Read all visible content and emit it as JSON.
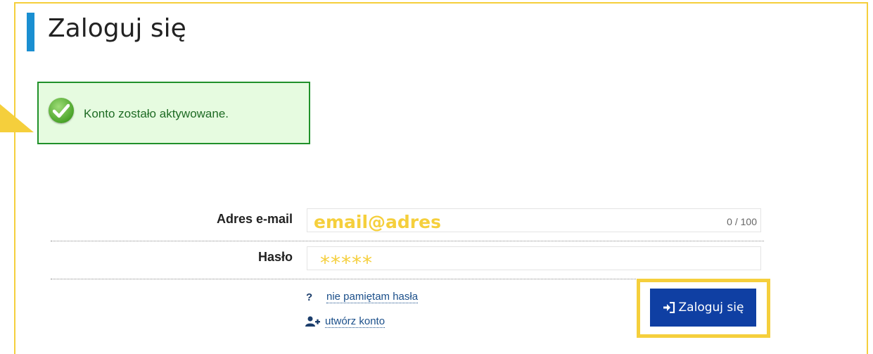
{
  "page": {
    "title": "Zaloguj się"
  },
  "alert": {
    "message": "Konto zostało aktywowane.",
    "icon": "check-circle-icon",
    "color": "#20912a"
  },
  "form": {
    "email": {
      "label": "Adres e-mail",
      "value": "email@adres",
      "counter": "0 / 100"
    },
    "password": {
      "label": "Hasło",
      "value": "*****"
    }
  },
  "links": {
    "forgot_icon": "?",
    "forgot_password": "nie pamiętam hasła",
    "create_account": "utwórz konto"
  },
  "submit": {
    "label": "Zaloguj się",
    "icon": "sign-in-icon",
    "color": "#0f3fa3"
  },
  "highlight_color": "#f5cf3c",
  "accent_color": "#1a8fd1"
}
